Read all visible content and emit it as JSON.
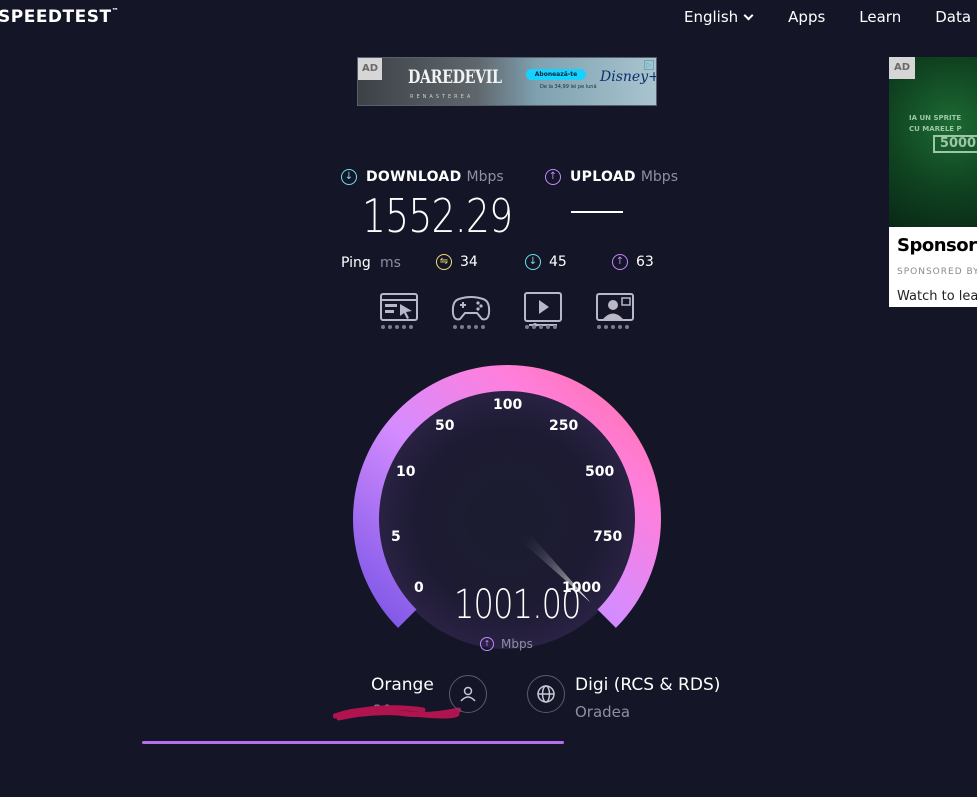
{
  "header": {
    "logo": "SPEEDTEST",
    "nav": {
      "language": "English",
      "apps": "Apps",
      "learn": "Learn",
      "data": "Data"
    }
  },
  "top_ad": {
    "tag": "AD",
    "title": "DAREDEVIL",
    "subtitle": "RENASTEREA",
    "cta": "Abonează-te",
    "price": "De la 34,99 lei pe lună",
    "brand": "Disney+"
  },
  "side_ad": {
    "tag": "AD",
    "line1": "IA UN SPRITE",
    "line2": "CU MARELE P",
    "badge": "5000",
    "heading": "Sponsor",
    "sponsored_by": "SPONSORED BY",
    "watch": "Watch to lea"
  },
  "results": {
    "download": {
      "label": "DOWNLOAD",
      "unit": "Mbps",
      "value": "1552.29"
    },
    "upload": {
      "label": "UPLOAD",
      "unit": "Mbps"
    },
    "ping": {
      "label": "Ping",
      "unit": "ms",
      "idle": "34",
      "download": "45",
      "upload": "63"
    }
  },
  "ux_icons": [
    "browsing-icon",
    "gaming-icon",
    "video-streaming-icon",
    "video-call-icon"
  ],
  "gauge": {
    "labels": [
      "0",
      "5",
      "10",
      "50",
      "100",
      "250",
      "500",
      "750",
      "1000"
    ],
    "value": "1001.00",
    "unit": "Mbps",
    "needle_fraction": 1.0
  },
  "connection": {
    "isp": "Orange",
    "ip": "36",
    "server": "Digi (RCS & RDS)",
    "location": "Oradea"
  },
  "progress_fraction": 0.5,
  "colors": {
    "background": "#141526",
    "download": "#6ee0ef",
    "upload": "#c488ff",
    "ping": "#f0e07a",
    "gauge_start": "#7a55e6",
    "gauge_end": "#ff6fa6"
  }
}
